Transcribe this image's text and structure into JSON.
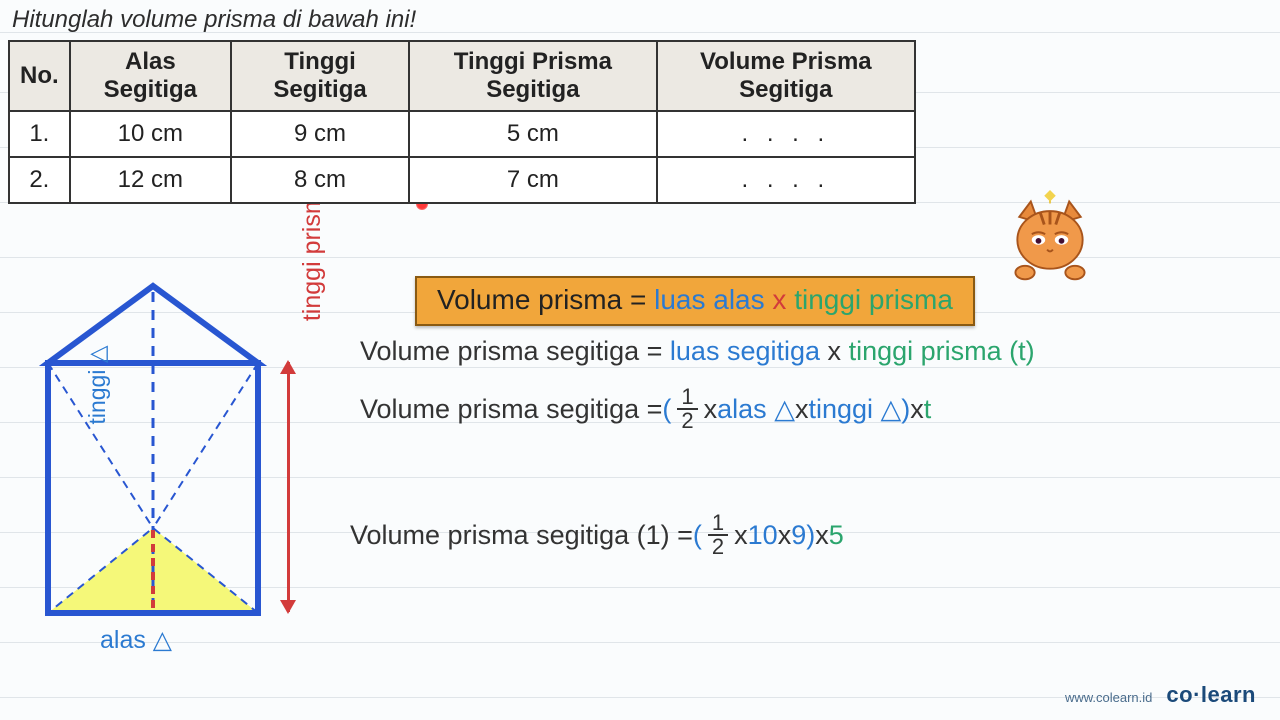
{
  "title": "Hitunglah volume prisma di bawah ini!",
  "table": {
    "headers": {
      "no": "No.",
      "alas": "Alas Segitiga",
      "tinggi_seg": "Tinggi Segitiga",
      "tinggi_pris": "Tinggi Prisma Segitiga",
      "volume": "Volume Prisma Segitiga"
    },
    "rows": [
      {
        "no": "1.",
        "alas": "10 cm",
        "tinggi_seg": "9 cm",
        "tinggi_pris": "5 cm",
        "volume": ". . . ."
      },
      {
        "no": "2.",
        "alas": "12 cm",
        "tinggi_seg": "8 cm",
        "tinggi_pris": "7 cm",
        "volume": ". . . ."
      }
    ]
  },
  "formula": {
    "lhs": "Volume prisma = ",
    "luas_alas": "luas alas",
    "x": " x ",
    "tinggi_prisma": "tinggi prisma"
  },
  "expl1": {
    "lhs": "Volume prisma segitiga =  ",
    "luas": "luas segitiga",
    "x": " x ",
    "tp": "tinggi prisma (t)"
  },
  "expl2": {
    "lhs": "Volume prisma segitiga = ",
    "open": "( ",
    "half_n": "1",
    "half_d": "2",
    "x1": " x ",
    "alas": "alas △",
    "x2": " x ",
    "tinggi": "tinggi △",
    "close": " )",
    "x3": " x ",
    "t": "t"
  },
  "expl3": {
    "lhs": "Volume prisma segitiga (1) = ",
    "open": "( ",
    "half_n": "1",
    "half_d": "2",
    "x1": " x ",
    "v1": "10",
    "x2": " x ",
    "v2": "9",
    "close": ")",
    "x3": " x ",
    "v3": "5"
  },
  "diagram_labels": {
    "tinggi_prisma": "tinggi prisma (t)",
    "tinggi_tri": "tinggi △",
    "alas": "alas △"
  },
  "brand": {
    "site": "www.colearn.id",
    "logo": "co·learn"
  },
  "colors": {
    "blue": "#2b7ad1",
    "green": "#2ba56d",
    "red": "#d23b3b",
    "orange": "#f1a63b"
  },
  "chart_data": {
    "type": "table",
    "title": "Hitunglah volume prisma di bawah ini!",
    "columns": [
      "No.",
      "Alas Segitiga (cm)",
      "Tinggi Segitiga (cm)",
      "Tinggi Prisma Segitiga (cm)",
      "Volume Prisma Segitiga"
    ],
    "rows": [
      [
        1,
        10,
        9,
        5,
        null
      ],
      [
        2,
        12,
        8,
        7,
        null
      ]
    ],
    "formula": "Volume prisma = luas alas × tinggi prisma = (1/2 × alas △ × tinggi △) × t",
    "worked_example": "Volume prisma segitiga (1) = (1/2 × 10 × 9) × 5"
  }
}
